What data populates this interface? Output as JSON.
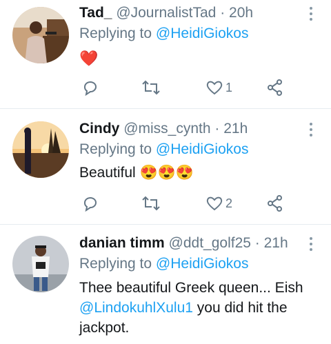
{
  "tweets": [
    {
      "name": "Tad_",
      "handle": "@JournalistTad",
      "time": "· 20h",
      "replying_prefix": "Replying to",
      "replying_to": "@HeidiGiokos",
      "text": "❤️",
      "likes": "1",
      "retweets": "",
      "replies": ""
    },
    {
      "name": "Cindy",
      "handle": "@miss_cynth",
      "time": "· 21h",
      "replying_prefix": "Replying to",
      "replying_to": "@HeidiGiokos",
      "text": "Beautiful 😍😍😍",
      "likes": "2",
      "retweets": "",
      "replies": ""
    },
    {
      "name": "danian timm",
      "handle": "@ddt_golf25",
      "time": "· 21h",
      "replying_prefix": "Replying to",
      "replying_to": "@HeidiGiokos",
      "text_before": "Thee beautiful Greek queen... Eish",
      "text_mention": "@LindokuhlXulu1",
      "text_after": " you did hit the jackpot."
    }
  ],
  "colors": {
    "link": "#1da1f2",
    "secondary": "#657786",
    "divider": "#e6ecf0"
  }
}
